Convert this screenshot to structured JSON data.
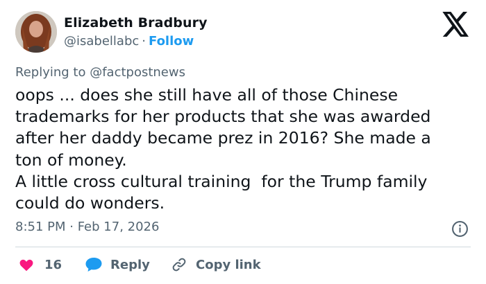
{
  "author": {
    "name": "Elizabeth Bradbury",
    "handle": "@isabellabc",
    "separator": "·",
    "follow_label": "Follow"
  },
  "replying_to": "Replying to @factpostnews",
  "tweet": {
    "text": "oops ... does she still have all of those Chinese\ntrademarks for her products that she was awarded\nafter her daddy became prez in 2016? She made a\nton of money.\nA little cross cultural training  for the Trump family\ncould do wonders.",
    "timestamp": "8:51 PM · Feb 17, 2026"
  },
  "actions": {
    "like_count": "16",
    "reply_label": "Reply",
    "copy_link_label": "Copy link"
  },
  "icons": {
    "logo": "x-logo-icon",
    "info": "info-icon",
    "like": "heart-icon",
    "reply": "speech-bubble-icon",
    "copy": "link-icon"
  },
  "colors": {
    "accent": "#1d9bf0",
    "like": "#f91880",
    "muted": "#536471",
    "text": "#0f1419"
  }
}
